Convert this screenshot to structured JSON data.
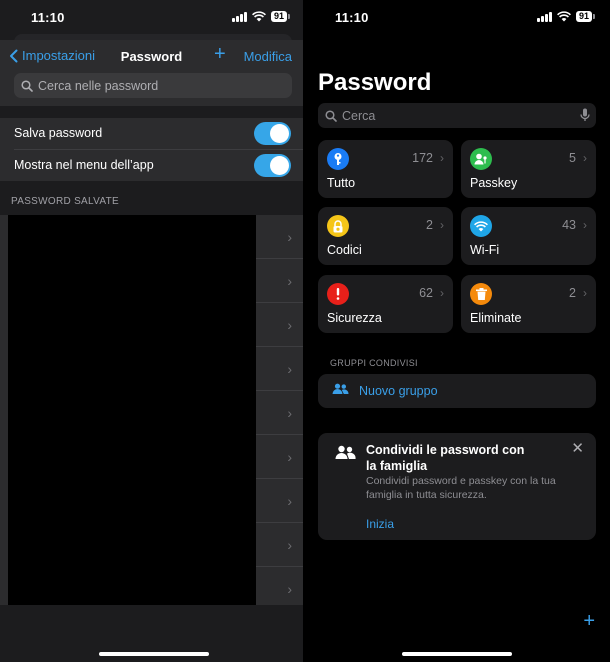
{
  "left": {
    "status": {
      "time": "11:10",
      "battery": "91"
    },
    "nav": {
      "back_label": "Impostazioni",
      "title": "Password",
      "add_label": "+",
      "edit_label": "Modifica"
    },
    "search": {
      "placeholder": "Cerca nelle password"
    },
    "toggles": [
      {
        "label": "Salva password",
        "on": true
      },
      {
        "label": "Mostra nel menu dell’app",
        "on": true
      }
    ],
    "section_title": "PASSWORD SALVATE",
    "saved_rows": 9
  },
  "right": {
    "status": {
      "time": "11:10",
      "battery": "91"
    },
    "title": "Password",
    "search": {
      "placeholder": "Cerca"
    },
    "categories": [
      {
        "label": "Tutto",
        "count": "172",
        "color": "#1a7cf5",
        "icon": "key-icon"
      },
      {
        "label": "Passkey",
        "count": "5",
        "color": "#2dbd4e",
        "icon": "person-key-icon"
      },
      {
        "label": "Codici",
        "count": "2",
        "color": "#f5c518",
        "icon": "lock-clock-icon"
      },
      {
        "label": "Wi-Fi",
        "count": "43",
        "color": "#1fa6e8",
        "icon": "wifi-icon"
      },
      {
        "label": "Sicurezza",
        "count": "62",
        "color": "#e8201a",
        "icon": "exclamation-icon"
      },
      {
        "label": "Eliminate",
        "count": "2",
        "color": "#f58a0c",
        "icon": "trash-icon"
      }
    ],
    "shared_groups": {
      "section_title": "GRUPPI CONDIVISI",
      "new_group_label": "Nuovo gruppo"
    },
    "family_card": {
      "title": "Condividi le password con la famiglia",
      "description": "Condividi password e passkey con la tua famiglia in tutta sicurezza.",
      "action": "Inizia",
      "close": "✕"
    },
    "add_label": "+"
  }
}
